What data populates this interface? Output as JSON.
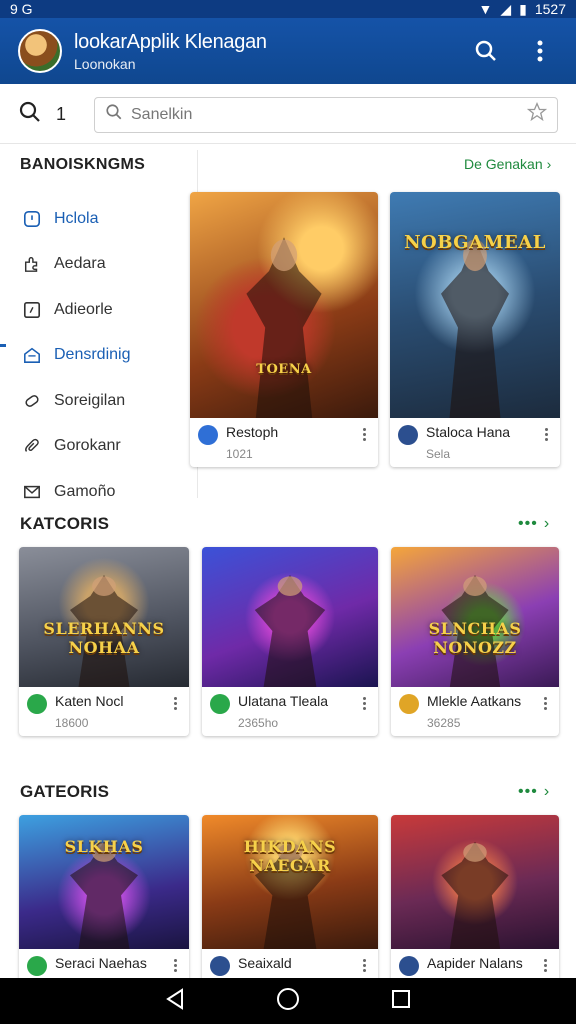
{
  "status": {
    "left": "9 G",
    "time": "1527"
  },
  "app": {
    "title": "lookarApplik Klenagan",
    "subtitle": "Loonokan"
  },
  "search": {
    "count": "1",
    "placeholder": "Sanelkin"
  },
  "sidebar": {
    "heading": "BANOISKNGMS",
    "items": [
      {
        "label": "Hclola",
        "icon": "clock-icon",
        "active": true
      },
      {
        "label": "Aedara",
        "icon": "puzzle-icon",
        "active": false
      },
      {
        "label": "Adieorle",
        "icon": "square-icon",
        "active": false
      },
      {
        "label": "Densrdinig",
        "icon": "inbox-icon",
        "active": true
      },
      {
        "label": "Soreigilan",
        "icon": "tag-icon",
        "active": false
      },
      {
        "label": "Gorokanr",
        "icon": "link-icon",
        "active": false
      },
      {
        "label": "Gamoño",
        "icon": "mail-icon",
        "active": false
      }
    ]
  },
  "featured": {
    "more_label": "De Genakan",
    "cards": [
      {
        "title": "Restoph",
        "sub": "1021",
        "art_text": "TOENA",
        "dot_color": "#2f6fd6"
      },
      {
        "title": "Staloca Hana",
        "sub": "Sela",
        "art_text": "NOBGAMEAL",
        "dot_color": "#2c4f8f"
      }
    ]
  },
  "sections": [
    {
      "heading": "KATCORIS",
      "more": "•••",
      "cards": [
        {
          "title": "Katen Nocl",
          "sub": "18600",
          "art_text": "SLERHANNS NOHAA",
          "dot_color": "#2aa84a"
        },
        {
          "title": "Ulatana Tleala",
          "sub": "2365ho",
          "art_text": "",
          "dot_color": "#2aa84a"
        },
        {
          "title": "Mlekle Aatkans",
          "sub": "36285",
          "art_text": "SLNCHAS NONOZZ",
          "dot_color": "#e0a526"
        }
      ]
    },
    {
      "heading": "GATEORIS",
      "more": "•••",
      "cards": [
        {
          "title": "Seraci Naehas",
          "sub": "",
          "art_text": "SLKHAS",
          "dot_color": "#2aa84a"
        },
        {
          "title": "Seaixald",
          "sub": "",
          "art_text": "HIKDANS NAEGAR",
          "dot_color": "#2c4f8f"
        },
        {
          "title": "Aapider Nalans",
          "sub": "",
          "art_text": "",
          "dot_color": "#2c4f8f"
        }
      ]
    }
  ],
  "colors": {
    "appbar": "#1553a8",
    "accent": "#1a5fb4",
    "green": "#1f8a3e"
  }
}
